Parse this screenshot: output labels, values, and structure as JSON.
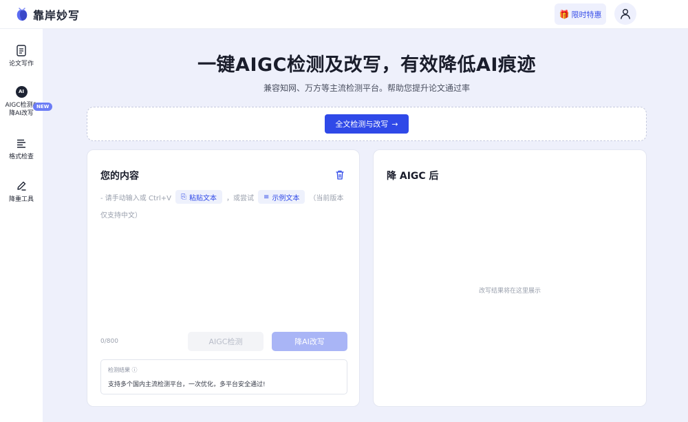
{
  "app": {
    "name": "靠岸妙写",
    "promo_label": "限时特惠"
  },
  "sidebar": {
    "items": [
      {
        "label": "论文写作",
        "icon": "document-icon"
      },
      {
        "label": "AIGC检测&降AI改写",
        "icon": "ai-badge-icon"
      },
      {
        "label": "格式检查",
        "icon": "format-list-icon",
        "badge": "NEW"
      },
      {
        "label": "降重工具",
        "icon": "pen-icon"
      }
    ],
    "ai_badge_text": "AI"
  },
  "hero": {
    "title": "一键AIGC检测及改写，有效降低AI痕迹",
    "subtitle": "兼容知网、万方等主流检测平台。帮助您提升论文通过率",
    "primary_button": "全文检测与改写"
  },
  "left_panel": {
    "title": "您的内容",
    "hint_prefix": "- 请手动输入或 Ctrl+V",
    "paste_chip": "粘贴文本",
    "hint_middle": "，或尝试",
    "example_chip": "示例文本",
    "hint_suffix": "（当前版本",
    "hint_line2": "仅支持中文）",
    "counter": "0/800",
    "detect_button": "AIGC检测",
    "rewrite_button": "降AI改写",
    "result_label": "检测结果 ⓘ",
    "result_text": "支持多个国内主流检测平台，一次优化，多平台安全通过!"
  },
  "right_panel": {
    "title": "降 AIGC 后",
    "placeholder": "改写结果将在这里展示"
  },
  "colors": {
    "accent": "#2f49e8",
    "background": "#eef0fb",
    "disabled_accent": "#a9b5f6"
  }
}
